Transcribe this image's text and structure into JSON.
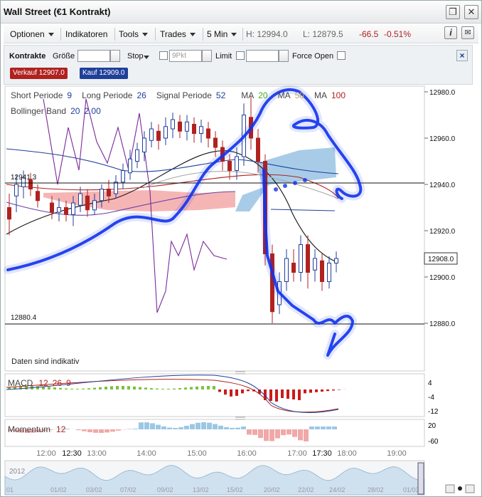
{
  "window": {
    "title": "Wall Street (€1 Kontrakt)"
  },
  "toolbar": {
    "menus": [
      "Optionen",
      "Indikatoren",
      "Tools",
      "Trades",
      "5 Min"
    ],
    "high": "H: 12994.0",
    "low": "L: 12879.5",
    "change": "-66.5",
    "change_pct": "-0.51%",
    "info_label": "i"
  },
  "trade": {
    "kontrakte": "Kontrakte",
    "groesse": "Größe",
    "stop": "Stop",
    "stop_placeholder": "9Pkt",
    "limit": "Limit",
    "force_open": "Force Open",
    "sell": "Verkauf 12907.0",
    "buy": "Kauf 12909.0"
  },
  "legend": {
    "short": "Short Periode",
    "short_val": "9",
    "long": "Long Periode",
    "long_val": "26",
    "signal": "Signal Periode",
    "signal_val": "52",
    "ma1": "MA",
    "ma1_val": "20",
    "ma2": "MA",
    "ma2_val": "50",
    "ma3": "MA",
    "ma3_val": "100",
    "bollinger": "Bollinger Band",
    "boll_a": "20",
    "boll_b": "2.00"
  },
  "price_axis": {
    "ticks": [
      "12980.0",
      "12960.0",
      "12940.0",
      "12920.0",
      "12900.0",
      "12880.0"
    ],
    "current": "12908.0"
  },
  "levels": {
    "hline1": "12941.3",
    "hline2": "12880.4"
  },
  "disclaimer": "Daten sind indikativ",
  "macd": {
    "label": "MACD",
    "a": "12",
    "b": "26",
    "c": "9",
    "ticks": [
      "4",
      "-4",
      "-12"
    ]
  },
  "momentum": {
    "label": "Momentum",
    "val": "12",
    "ticks": [
      "20",
      "-60"
    ]
  },
  "time_axis": [
    "12:00",
    "12:30",
    "13:00",
    "14:00",
    "15:00",
    "16:00",
    "17:00",
    "17:30",
    "18:00",
    "19:00"
  ],
  "navigator": {
    "year": "2012",
    "dates": [
      "01",
      "01/02",
      "03/02",
      "07/02",
      "09/02",
      "13/02",
      "15/02",
      "20/02",
      "22/02",
      "24/02",
      "28/02",
      "01/03"
    ]
  },
  "colors": {
    "bull": "#1f3f9a",
    "bear": "#b0221f",
    "annot": "#1133ee"
  }
}
